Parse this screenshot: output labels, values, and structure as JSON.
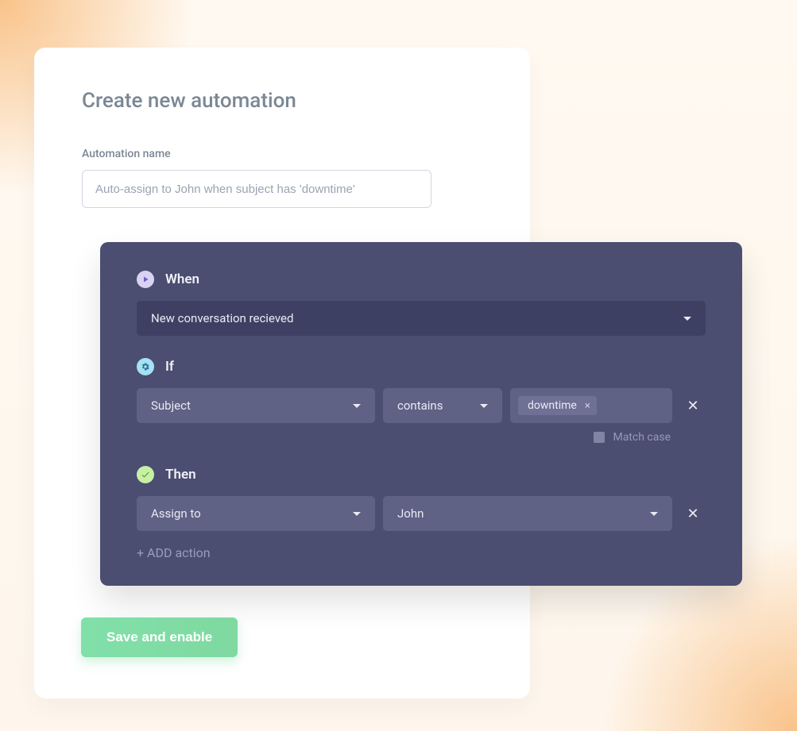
{
  "header": {
    "title": "Create new automation"
  },
  "name_field": {
    "label": "Automation name",
    "placeholder": "Auto-assign to John when subject has 'downtime'",
    "value": ""
  },
  "rules": {
    "when": {
      "label": "When",
      "trigger": "New conversation recieved"
    },
    "if": {
      "label": "If",
      "field": "Subject",
      "operator": "contains",
      "values": [
        "downtime"
      ],
      "match_case_label": "Match case",
      "match_case": false
    },
    "then": {
      "label": "Then",
      "action": "Assign to",
      "target": "John",
      "add_action_label": "+ ADD action"
    }
  },
  "buttons": {
    "save": "Save and enable"
  }
}
